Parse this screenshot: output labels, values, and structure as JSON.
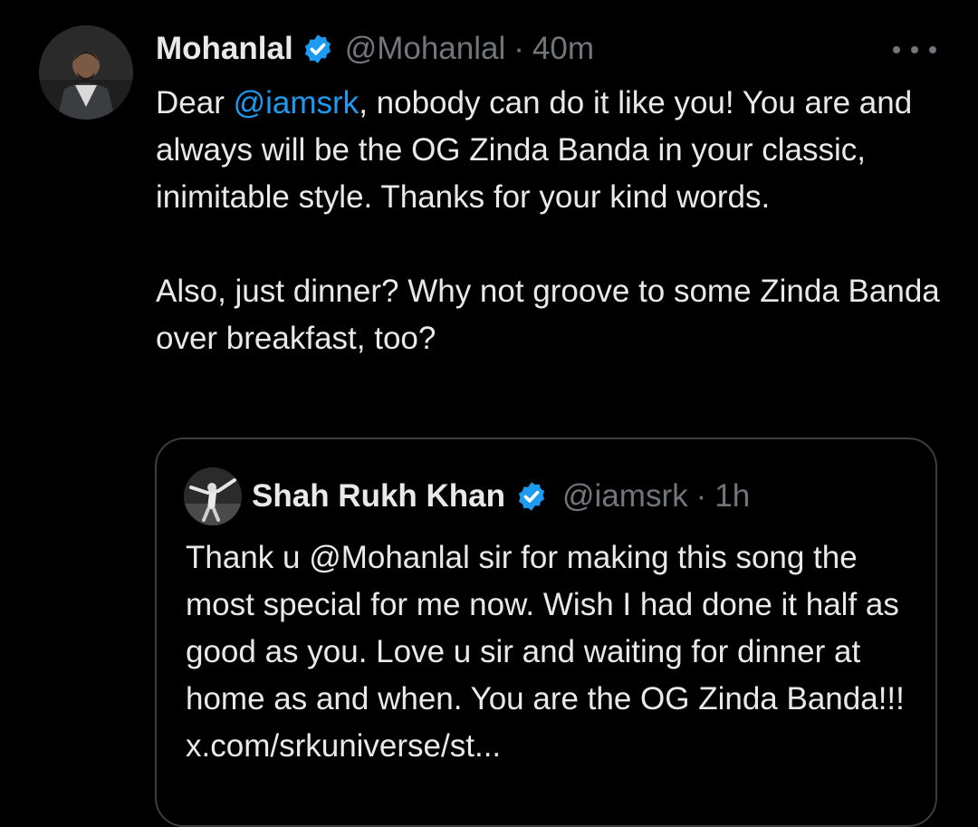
{
  "tweet": {
    "author_name": "Mohanlal",
    "handle": "@Mohanlal",
    "separator": "·",
    "time": "40m",
    "text_before_mention": "Dear ",
    "mention": "@iamsrk",
    "text_after_mention": ", nobody can do it like you! You are and always will be the OG Zinda Banda in your classic, inimitable style. Thanks for your kind words.",
    "text_paragraph_2": "Also, just dinner? Why not groove to some Zinda Banda over breakfast, too?"
  },
  "quote": {
    "author_name": "Shah Rukh Khan",
    "handle": "@iamsrk",
    "separator": "·",
    "time": "1h",
    "text": "Thank u @Mohanlal sir for making this song the most special for me now. Wish I had done it half as good as you. Love u sir and waiting for dinner at home as and when. You are the OG Zinda Banda!!! x.com/srkuniverse/st..."
  },
  "icons": {
    "verified": "verified-badge-icon",
    "more": "more-options-icon"
  },
  "colors": {
    "background": "#000000",
    "text": "#e7e9ea",
    "secondary": "#71767b",
    "accent": "#1d9bf0",
    "border": "#3a3d41"
  }
}
